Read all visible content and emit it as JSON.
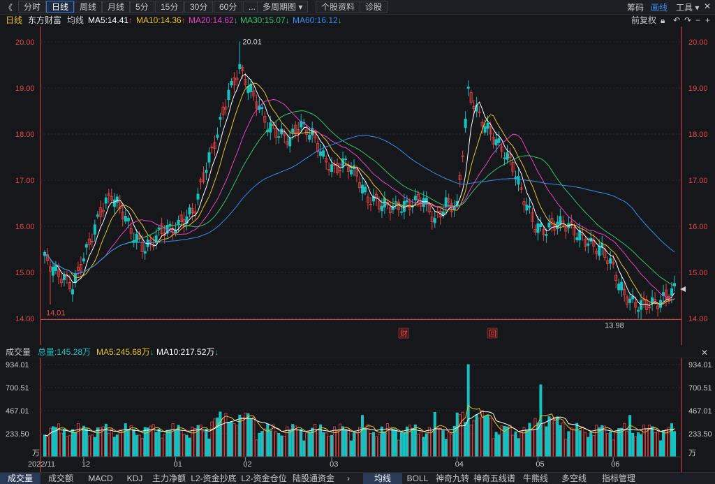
{
  "toolbar": {
    "back_label": "《",
    "periods": [
      "分时",
      "日线",
      "周线",
      "月线",
      "5分",
      "15分",
      "30分",
      "60分",
      "...",
      "多周期图",
      "个股资料",
      "诊股"
    ],
    "active_index": 1,
    "right_items": [
      "筹码",
      "画线",
      "工具"
    ]
  },
  "ma_row": {
    "period": "日线",
    "stock_name": "东方财富",
    "mode": "均线",
    "ma5": "MA5:14.41",
    "ma10": "MA10:14.36",
    "ma20": "MA20:14.62",
    "ma30": "MA30:15.07",
    "ma60": "MA60:16.12",
    "adjust": "前复权"
  },
  "colors": {
    "up": "#e64545",
    "down": "#14c2c2",
    "ma5": "#ffffff",
    "ma10": "#e8c21b",
    "ma20": "#e83fc8",
    "ma30": "#2fc36a",
    "ma60": "#2f8cf0",
    "axis": "#e64545",
    "grid": "#2a2b30"
  },
  "price_axis": {
    "ticks": [
      "20.00",
      "19.00",
      "18.00",
      "17.00",
      "16.00",
      "15.00",
      "14.00"
    ],
    "high_label": "20.01",
    "low_label": "13.98",
    "left_low_label": "14.01",
    "event_markers": [
      "财",
      "回"
    ]
  },
  "volume": {
    "title": "成交量",
    "total": "总量:145.28万",
    "ma5": "MA5:245.68万",
    "ma10": "MA10:217.52万",
    "ticks": [
      "934.01",
      "700.51",
      "467.01",
      "233.50"
    ],
    "unit": "万"
  },
  "x_axis": {
    "labels": [
      "2022/11",
      "12",
      "01",
      "02",
      "03",
      "04",
      "05",
      "06"
    ]
  },
  "bottom_tabs": [
    "成交量",
    "成交额",
    "MACD",
    "KDJ",
    "主力净额",
    "L2-资金抄底",
    "L2-资金仓位",
    "陆股通资金",
    "均线",
    "BOLL",
    "神奇九转",
    "神奇五线谱",
    "牛熊线",
    "多空线",
    "指标管理"
  ],
  "bottom_active": [
    0,
    8
  ]
}
